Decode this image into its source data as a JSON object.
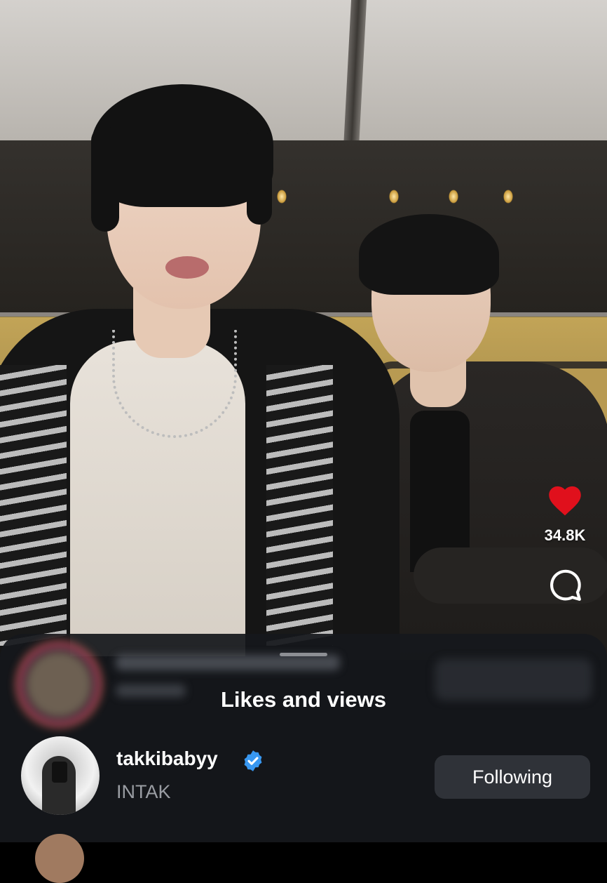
{
  "video": {
    "like_count": "34.8K"
  },
  "icons": {
    "like": "heart-icon",
    "comment": "comment-bubble-icon",
    "verified": "verified-badge-icon"
  },
  "colors": {
    "heart": "#e0101c",
    "verified": "#3897f0",
    "sheet_bg": "#16181c",
    "button_bg": "#2f3238"
  },
  "sheet": {
    "title": "Likes and views",
    "users": [
      {
        "username": "takkibabyy",
        "full_name": "INTAK",
        "verified": true,
        "button_label": "Following"
      }
    ]
  }
}
